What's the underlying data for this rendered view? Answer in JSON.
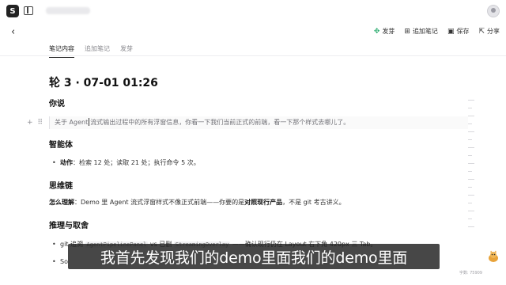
{
  "toolbar": {
    "sprout_label": "发芽",
    "append_label": "追加笔记",
    "save_label": "保存",
    "share_label": "分享",
    "accent_color": "#2fae72"
  },
  "tabs": [
    {
      "label": "笔记内容",
      "active": true
    },
    {
      "label": "追加笔记",
      "active": false
    },
    {
      "label": "发芽",
      "active": false
    }
  ],
  "note": {
    "round_title": "轮 3 · 07-01 01:26",
    "you_said_heading": "你说",
    "user_message_a": "关于 Agent",
    "user_message_b": "流式输出过程中的所有浮窗信息，你看一下我们当前正式的前端，看一下那个样式去哪儿了。",
    "agent_heading": "智能体",
    "action_label": "动作",
    "action_text": "：检索 12 处；读取 21 处；执行命令 5 次。",
    "chain_heading": "思维链",
    "understand_label": "怎么理解",
    "understand_text_a": "：Demo 里 Agent 流式浮窗样式不像正式前端——你要的是",
    "understand_bold": "对照现行产品",
    "understand_text_b": "，不是 git 考古讲义。",
    "reasoning_heading": "推理与取舍",
    "bullet1_a": "git 追溯 ",
    "bullet1_code1": "AgentPipelinePanel",
    "bullet1_b": " vs 已删 ",
    "bullet1_code2": "StreamingOverlay",
    "bullet1_c": " ——确认现行仍在 Layout 右下角 420px 三 Tab。",
    "bullet2_a": "So"
  },
  "footer": {
    "char_count": "字数: 75909"
  },
  "caption": {
    "text": "我首先发现我们的demo里面我们的demo里面"
  }
}
